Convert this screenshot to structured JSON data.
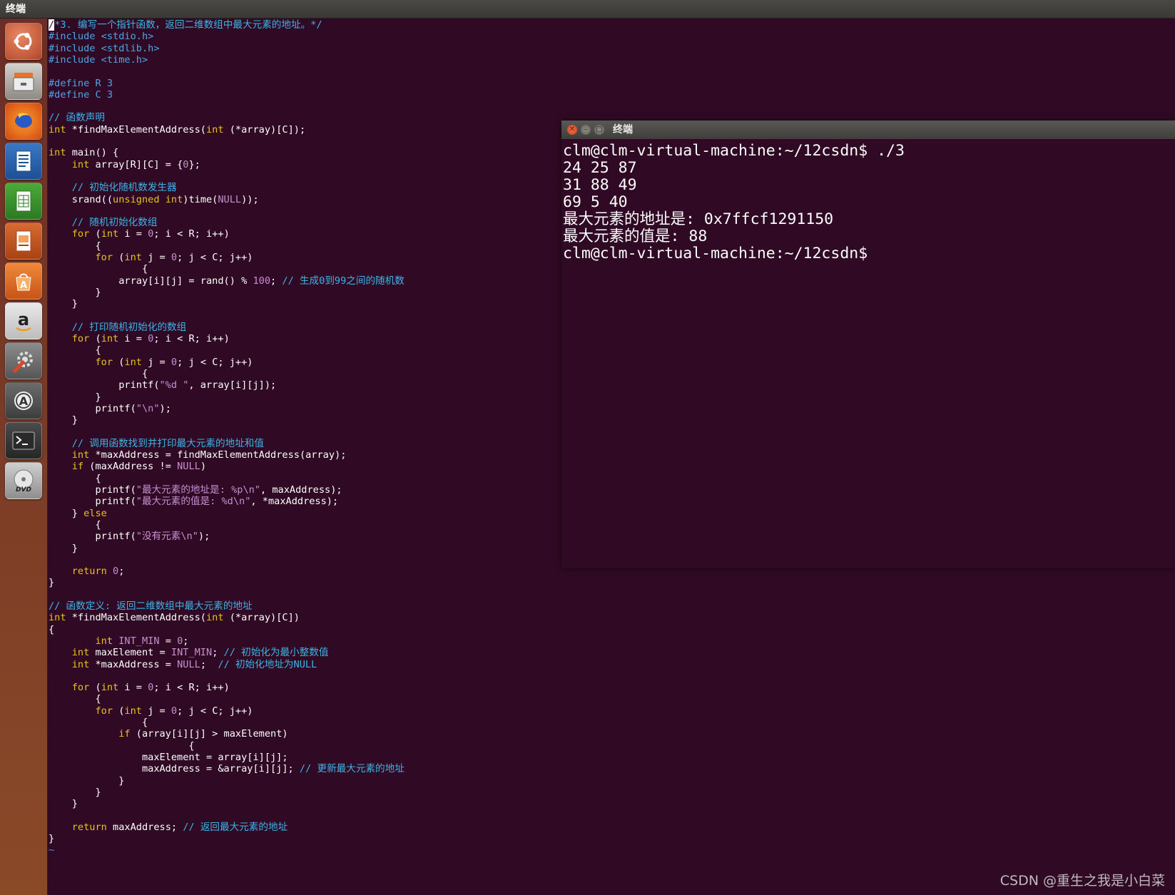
{
  "topbar": {
    "title": "终端"
  },
  "launcher": {
    "items": [
      {
        "name": "ubuntu-dash-icon"
      },
      {
        "name": "files-icon"
      },
      {
        "name": "firefox-icon"
      },
      {
        "name": "writer-icon"
      },
      {
        "name": "calc-icon"
      },
      {
        "name": "impress-icon"
      },
      {
        "name": "software-center-icon"
      },
      {
        "name": "amazon-icon"
      },
      {
        "name": "system-settings-icon"
      },
      {
        "name": "software-updater-icon"
      },
      {
        "name": "terminal-icon"
      },
      {
        "name": "dvd-icon"
      }
    ]
  },
  "editor": {
    "lines": [
      "/*3. 编写一个指针函数，返回二维数组中最大元素的地址。*/",
      "#include <stdio.h>",
      "#include <stdlib.h>",
      "#include <time.h>",
      "",
      "#define R 3",
      "#define C 3",
      "",
      "// 函数声明",
      "int *findMaxElementAddress(int (*array)[C]);",
      "",
      "int main() {",
      "    int array[R][C] = {0};",
      "",
      "    // 初始化随机数发生器",
      "    srand((unsigned int)time(NULL));",
      "",
      "    // 随机初始化数组",
      "    for (int i = 0; i < R; i++)",
      "        {",
      "        for (int j = 0; j < C; j++)",
      "                {",
      "            array[i][j] = rand() % 100; // 生成0到99之间的随机数",
      "        }",
      "    }",
      "",
      "    // 打印随机初始化的数组",
      "    for (int i = 0; i < R; i++)",
      "        {",
      "        for (int j = 0; j < C; j++)",
      "                {",
      "            printf(\"%d \", array[i][j]);",
      "        }",
      "        printf(\"\\n\");",
      "    }",
      "",
      "    // 调用函数找到并打印最大元素的地址和值",
      "    int *maxAddress = findMaxElementAddress(array);",
      "    if (maxAddress != NULL)",
      "        {",
      "        printf(\"最大元素的地址是: %p\\n\", maxAddress);",
      "        printf(\"最大元素的值是: %d\\n\", *maxAddress);",
      "    } else",
      "        {",
      "        printf(\"没有元素\\n\");",
      "    }",
      "",
      "    return 0;",
      "}",
      "",
      "// 函数定义: 返回二维数组中最大元素的地址",
      "int *findMaxElementAddress(int (*array)[C])",
      "{",
      "        int INT_MIN = 0;",
      "    int maxElement = INT_MIN; // 初始化为最小整数值",
      "    int *maxAddress = NULL;  // 初始化地址为NULL",
      "",
      "    for (int i = 0; i < R; i++)",
      "        {",
      "        for (int j = 0; j < C; j++)",
      "                {",
      "            if (array[i][j] > maxElement)",
      "                        {",
      "                maxElement = array[i][j];",
      "                maxAddress = &array[i][j]; // 更新最大元素的地址",
      "            }",
      "        }",
      "    }",
      "",
      "    return maxAddress; // 返回最大元素的地址",
      "}",
      "~"
    ]
  },
  "terminal": {
    "title": "终端",
    "lines": [
      "clm@clm-virtual-machine:~/12csdn$ ./3",
      "24 25 87",
      "31 88 49",
      "69 5 40",
      "最大元素的地址是: 0x7ffcf1291150",
      "最大元素的值是: 88",
      "clm@clm-virtual-machine:~/12csdn$ "
    ]
  },
  "watermark": "CSDN @重生之我是小白菜",
  "colors": {
    "background": "#300a24",
    "keyword": "#e6c21f",
    "comment": "#3db3e6",
    "preprocessor": "#4fa3e6",
    "string": "#c58fd1",
    "text": "#ffffff"
  }
}
